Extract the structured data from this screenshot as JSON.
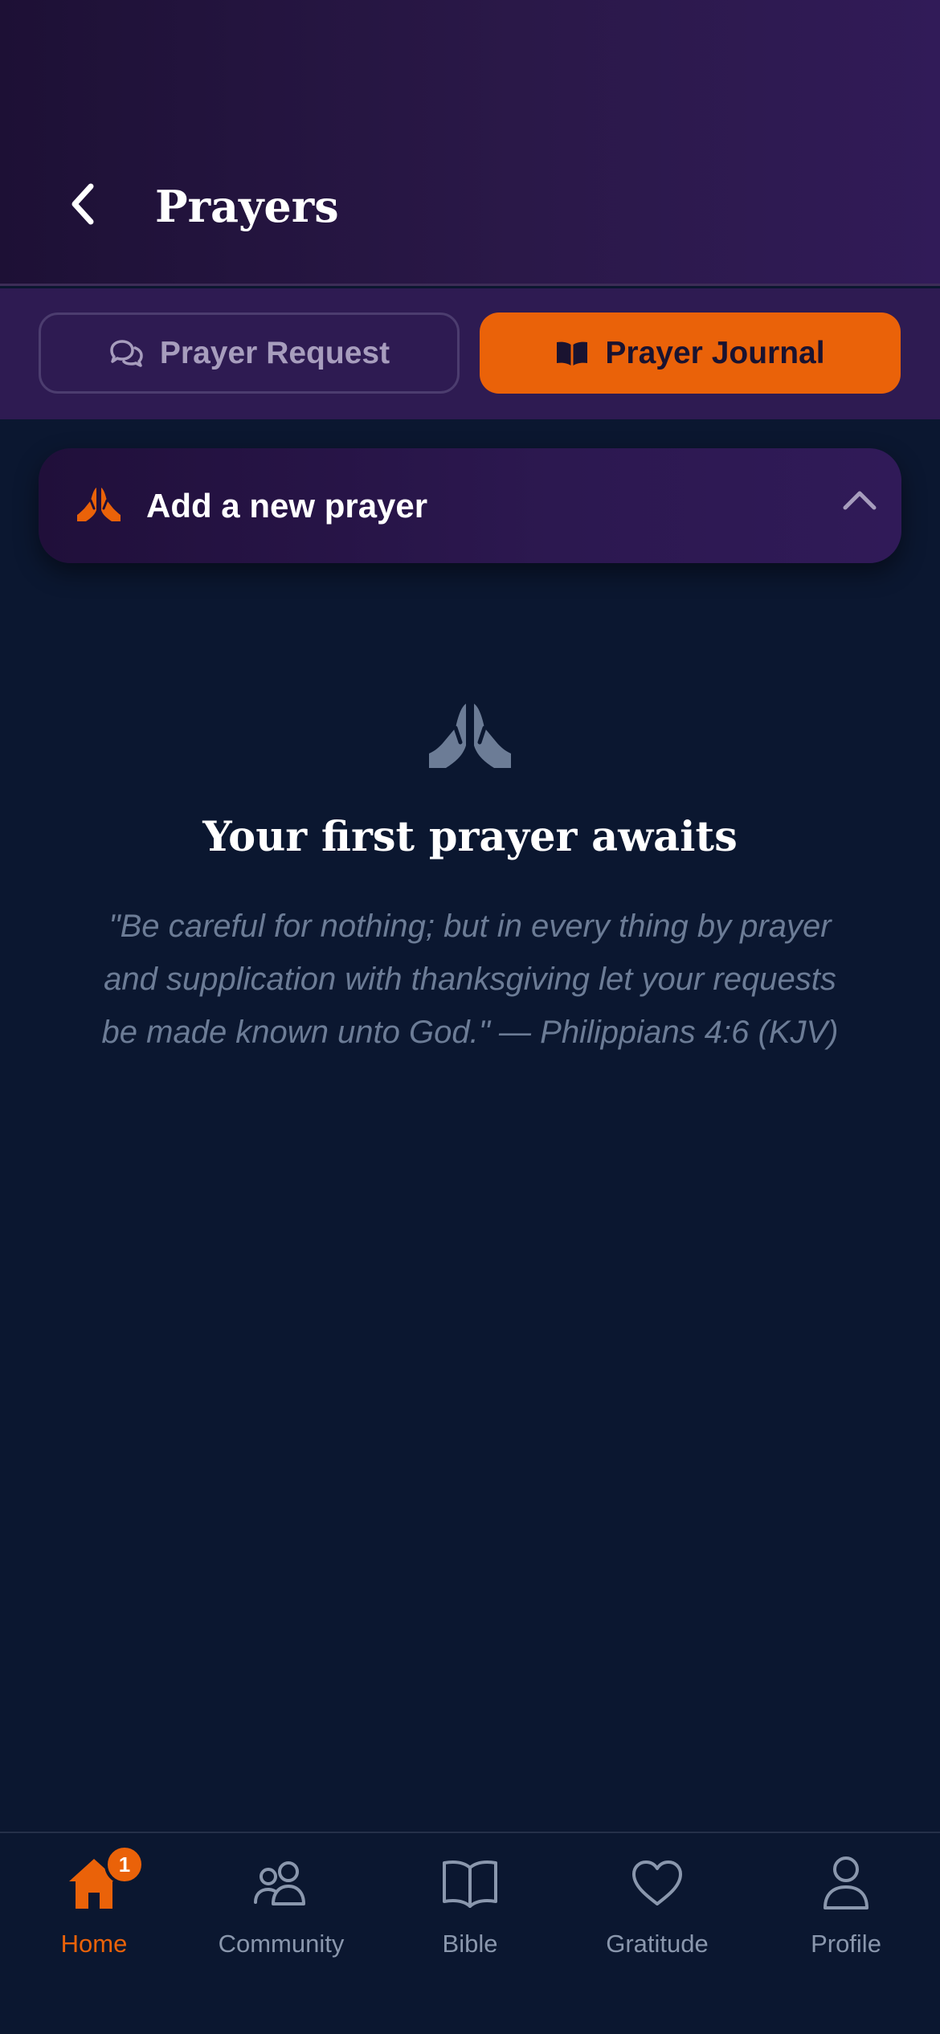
{
  "header": {
    "title": "Prayers",
    "back_icon": "chevron-left-icon"
  },
  "tabs": [
    {
      "label": "Prayer Request",
      "icon": "chat-bubbles-icon",
      "active": false
    },
    {
      "label": "Prayer Journal",
      "icon": "open-book-icon",
      "active": true
    }
  ],
  "add_prayer": {
    "label": "Add a new prayer",
    "icon": "praying-hands-icon",
    "toggle_icon": "chevron-up-icon"
  },
  "empty_state": {
    "icon": "praying-hands-icon",
    "title": "Your first prayer awaits",
    "quote": "\"Be careful for nothing; but in every thing by prayer and supplication with thanksgiving let your requests be made known unto God.\" — Philippians 4:6 (KJV)"
  },
  "bottom_nav": {
    "items": [
      {
        "label": "Home",
        "icon": "home-icon",
        "active": true,
        "badge": "1"
      },
      {
        "label": "Community",
        "icon": "users-icon",
        "active": false
      },
      {
        "label": "Bible",
        "icon": "book-icon",
        "active": false
      },
      {
        "label": "Gratitude",
        "icon": "heart-icon",
        "active": false
      },
      {
        "label": "Profile",
        "icon": "user-icon",
        "active": false
      }
    ]
  },
  "colors": {
    "accent": "#EA6209",
    "background": "#0B1730",
    "header_purple": "#2E1B52",
    "muted_text": "#6C7C96"
  }
}
